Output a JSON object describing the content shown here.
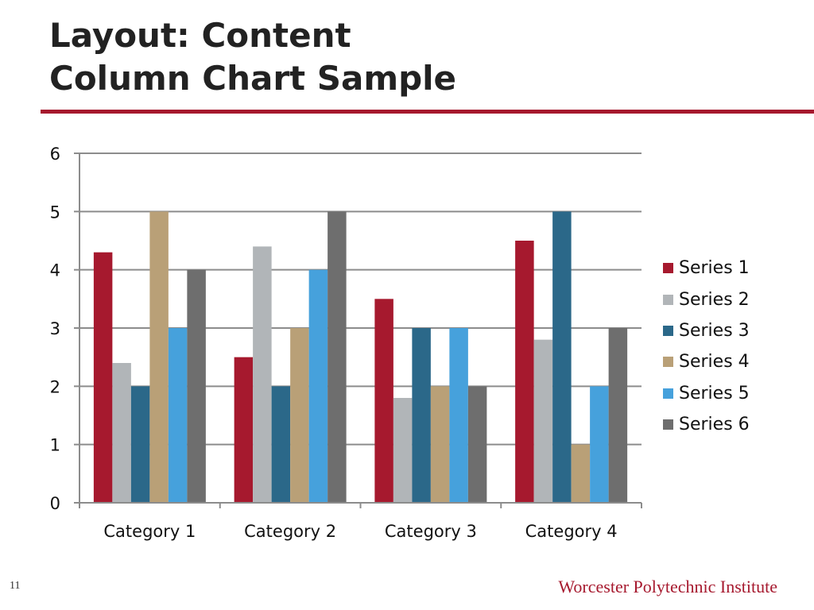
{
  "slide": {
    "title_line1": "Layout: Content",
    "title_line2": "Column Chart Sample",
    "page_number": "11",
    "organization": "Worcester Polytechnic Institute",
    "accent_color": "#a6192e"
  },
  "chart_data": {
    "type": "bar",
    "title": "",
    "xlabel": "",
    "ylabel": "",
    "ylim": [
      0,
      6
    ],
    "yticks": [
      "0",
      "1",
      "2",
      "3",
      "4",
      "5",
      "6"
    ],
    "grid": true,
    "legend_position": "right",
    "categories": [
      "Category 1",
      "Category 2",
      "Category 3",
      "Category 4"
    ],
    "series": [
      {
        "name": "Series 1",
        "color": "#a6192e",
        "values": [
          4.3,
          2.5,
          3.5,
          4.5
        ]
      },
      {
        "name": "Series 2",
        "color": "#b1b5b8",
        "values": [
          2.4,
          4.4,
          1.8,
          2.8
        ]
      },
      {
        "name": "Series 3",
        "color": "#2b6889",
        "values": [
          2,
          2,
          3,
          5
        ]
      },
      {
        "name": "Series 4",
        "color": "#b9a077",
        "values": [
          5,
          3,
          2,
          1
        ]
      },
      {
        "name": "Series 5",
        "color": "#46a1dc",
        "values": [
          3,
          4,
          3,
          2
        ]
      },
      {
        "name": "Series 6",
        "color": "#6e6e6e",
        "values": [
          4,
          5,
          2,
          3
        ]
      }
    ]
  }
}
